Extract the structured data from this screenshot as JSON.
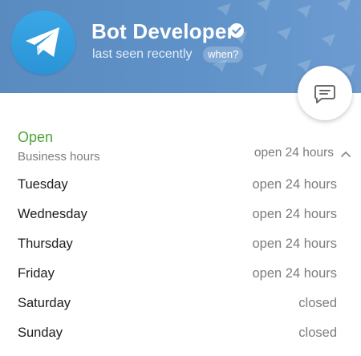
{
  "profile": {
    "name": "Bot Developer",
    "status": "last seen recently",
    "when_label": "when?"
  },
  "colors": {
    "header_bg": "#5f92c8",
    "avatar_bg": "#2a94d6",
    "open_green": "#4fa33a",
    "verified_bg": "#ffffff",
    "verified_check": "#5f92c8"
  },
  "icons": {
    "avatar": "telegram-plane-icon",
    "verified": "verified-badge-icon",
    "fab": "message-icon",
    "expand": "chevron-up-icon"
  },
  "business": {
    "open_status": "Open",
    "label": "Business hours",
    "summary": "open 24 hours",
    "days": [
      {
        "day": "Tuesday",
        "hours": "open 24 hours"
      },
      {
        "day": "Wednesday",
        "hours": "open 24 hours"
      },
      {
        "day": "Thursday",
        "hours": "open 24 hours"
      },
      {
        "day": "Friday",
        "hours": "open 24 hours"
      },
      {
        "day": "Saturday",
        "hours": "closed"
      },
      {
        "day": "Sunday",
        "hours": "closed"
      }
    ]
  }
}
